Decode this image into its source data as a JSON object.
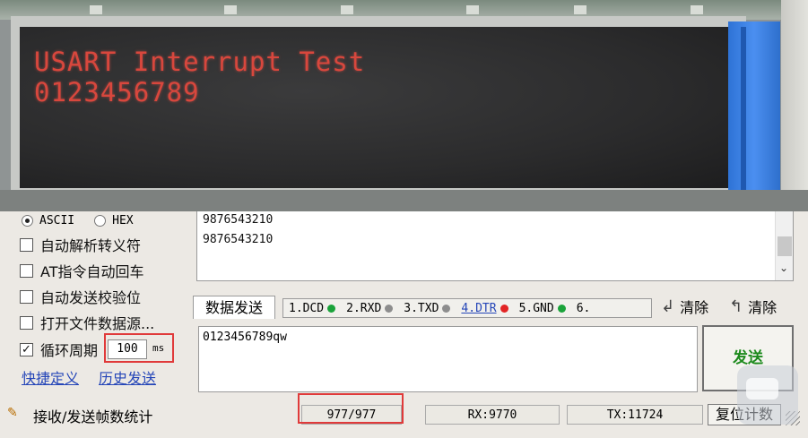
{
  "lcd": {
    "line1": "USART Interrupt Test",
    "line2": "0123456789"
  },
  "display_mode": {
    "ascii_label": "ASCII",
    "hex_label": "HEX",
    "selected": "ASCII"
  },
  "options": [
    {
      "label": "自动解析转义符",
      "checked": false
    },
    {
      "label": "AT指令自动回车",
      "checked": false
    },
    {
      "label": "自动发送校验位",
      "checked": false
    },
    {
      "label": "打开文件数据源...",
      "checked": false
    },
    {
      "label": "循环周期",
      "checked": true
    }
  ],
  "interval": {
    "value": "100",
    "unit": "ms"
  },
  "links": {
    "shortcut": "快捷定义",
    "history": "历史发送"
  },
  "receive": {
    "lines": [
      "9876543210",
      "9876543210"
    ]
  },
  "send_tab": {
    "label": "数据发送"
  },
  "pins": [
    {
      "label": "1.DCD",
      "state": "green"
    },
    {
      "label": "2.RXD",
      "state": "gray"
    },
    {
      "label": "3.TXD",
      "state": "gray"
    },
    {
      "label": "4.DTR",
      "state": "red"
    },
    {
      "label": "5.GND",
      "state": "green"
    },
    {
      "label": "6.",
      "state": "none"
    }
  ],
  "clear_labels": [
    "清除",
    "清除"
  ],
  "send": {
    "text": "0123456789qw",
    "button_label": "发送"
  },
  "status": {
    "label": "接收/发送帧数统计",
    "frames": "977/977",
    "rx": "RX:9770",
    "tx": "TX:11724",
    "reset_label": "复位计数"
  },
  "colors": {
    "lcd_text": "#d8473d",
    "link": "#2546b8",
    "highlight": "#e03a3a",
    "send_button_text": "#1d8a1d"
  }
}
